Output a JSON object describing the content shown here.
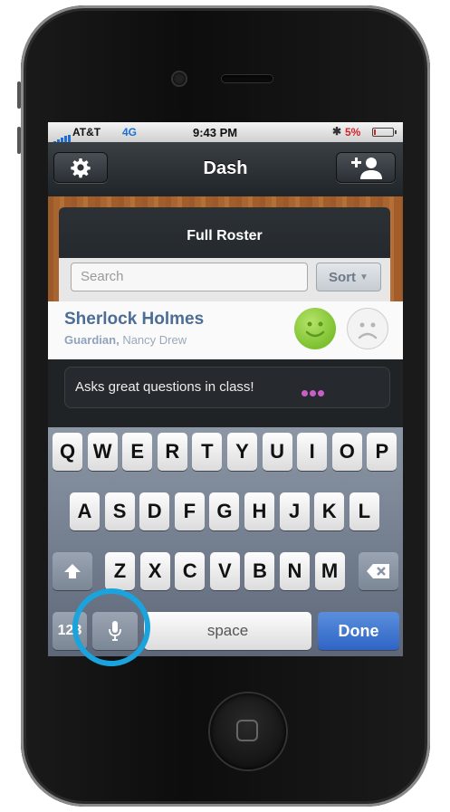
{
  "status_bar": {
    "carrier": "AT&T",
    "network": "4G",
    "time": "9:43 PM",
    "battery_percent": "5%"
  },
  "nav": {
    "title": "Dash",
    "settings_icon": "gear-icon",
    "add_icon": "add-person-icon"
  },
  "roster": {
    "title": "Full Roster",
    "search_placeholder": "Search",
    "sort_label": "Sort"
  },
  "student": {
    "name": "Sherlock Holmes",
    "relation": "Guardian,",
    "guardian": "Nancy Drew"
  },
  "comment": {
    "text": "Asks great questions in class!"
  },
  "keyboard": {
    "row1": [
      "Q",
      "W",
      "E",
      "R",
      "T",
      "Y",
      "U",
      "I",
      "O",
      "P"
    ],
    "row2": [
      "A",
      "S",
      "D",
      "F",
      "G",
      "H",
      "J",
      "K",
      "L"
    ],
    "row3": [
      "Z",
      "X",
      "C",
      "V",
      "B",
      "N",
      "M"
    ],
    "numbers_label": "123",
    "space_label": "space",
    "done_label": "Done"
  },
  "colors": {
    "accent_blue": "#2f64c6",
    "highlight": "#1aa3dc",
    "happy": "#7cc12f"
  }
}
